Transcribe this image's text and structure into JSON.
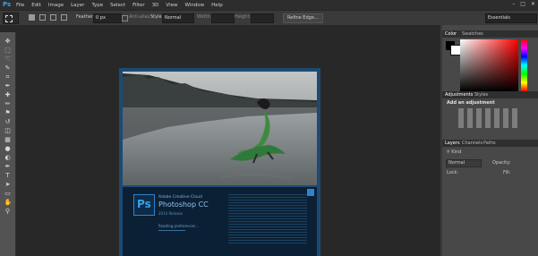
{
  "menubar": {
    "logo": "Ps",
    "items": [
      "File",
      "Edit",
      "Image",
      "Layer",
      "Type",
      "Select",
      "Filter",
      "3D",
      "View",
      "Window",
      "Help"
    ],
    "window_controls": [
      "–",
      "□",
      "✕"
    ]
  },
  "optionsbar": {
    "feather_label": "Feather:",
    "feather_value": "0 px",
    "antialias_label": "Anti-alias",
    "style_label": "Style:",
    "style_value": "Normal",
    "width_label": "Width:",
    "height_label": "Height:",
    "refine_button": "Refine Edge...",
    "workspace": "Essentials"
  },
  "tools": {
    "icons": [
      "move-icon",
      "marquee-icon",
      "lasso-icon",
      "quick-select-icon",
      "crop-icon",
      "eyedropper-icon",
      "healing-icon",
      "brush-icon",
      "stamp-icon",
      "history-brush-icon",
      "eraser-icon",
      "gradient-icon",
      "blur-icon",
      "dodge-icon",
      "pen-icon",
      "type-icon",
      "path-select-icon",
      "shape-icon",
      "hand-icon",
      "zoom-icon"
    ],
    "glyphs": [
      "✥",
      "⬚",
      "➰",
      "✎",
      "⌗",
      "✒",
      "✚",
      "✏",
      "⚑",
      "↺",
      "◫",
      "▦",
      "●",
      "◐",
      "✒",
      "T",
      "➤",
      "▭",
      "✋",
      "⚲"
    ]
  },
  "splash": {
    "brand_small": "Adobe Creative Cloud",
    "product": "Photoshop CC",
    "version": "2014 Release",
    "status": "Reading preferences..."
  },
  "panels": {
    "color_tabs": [
      "Color",
      "Swatches"
    ],
    "adjust_tabs": [
      "Adjustments",
      "Styles"
    ],
    "add_adjustment": "Add an adjustment",
    "layers_tabs": [
      "Layers",
      "Channels",
      "Paths"
    ],
    "kind_label": "Kind",
    "blend_mode": "Normal",
    "opacity_label": "Opacity:",
    "lock_label": "Lock:",
    "fill_label": "Fill:"
  },
  "colors": {
    "accent": "#2f84c9",
    "splash_frame": "#1d4a73"
  }
}
